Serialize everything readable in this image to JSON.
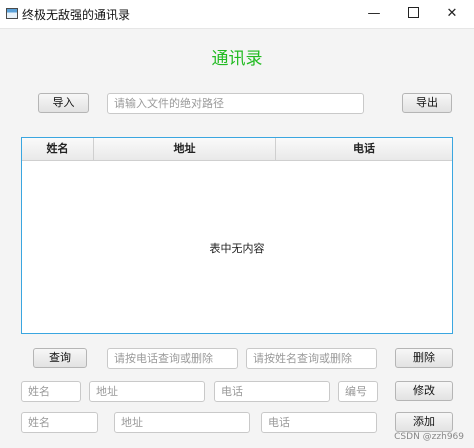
{
  "window": {
    "title": "终极无敌强的通讯录",
    "minimize_glyph": "—",
    "close_glyph": "✕"
  },
  "heading": "通讯录",
  "import_row": {
    "import_label": "导入",
    "path_placeholder": "请输入文件的绝对路径",
    "export_label": "导出"
  },
  "table": {
    "columns": [
      "姓名",
      "地址",
      "电话"
    ],
    "empty_text": "表中无内容"
  },
  "search_row": {
    "query_label": "查询",
    "phone_placeholder": "请按电话查询或删除",
    "name_placeholder": "请按姓名查询或删除",
    "delete_label": "删除"
  },
  "edit_row": {
    "name_placeholder": "姓名",
    "address_placeholder": "地址",
    "phone_placeholder": "电话",
    "id_placeholder": "编号",
    "modify_label": "修改"
  },
  "add_row": {
    "name_placeholder": "姓名",
    "address_placeholder": "地址",
    "phone_placeholder": "电话",
    "add_label": "添加"
  },
  "watermark": "CSDN @zzh969",
  "colors": {
    "heading": "#22bb22",
    "table_border": "#3aa6e0"
  }
}
